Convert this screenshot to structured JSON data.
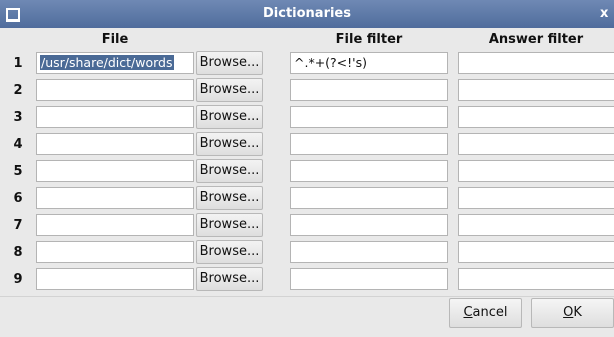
{
  "window": {
    "title": "Dictionaries",
    "close_glyph": "x"
  },
  "columns": {
    "file": "File",
    "file_filter": "File filter",
    "answer_filter": "Answer filter"
  },
  "rows": [
    {
      "num": "1",
      "file": "/usr/share/dict/words",
      "browse": "Browse...",
      "file_filter": "^.*+(?<!'s)",
      "answer_filter": ""
    },
    {
      "num": "2",
      "file": "",
      "browse": "Browse...",
      "file_filter": "",
      "answer_filter": ""
    },
    {
      "num": "3",
      "file": "",
      "browse": "Browse...",
      "file_filter": "",
      "answer_filter": ""
    },
    {
      "num": "4",
      "file": "",
      "browse": "Browse...",
      "file_filter": "",
      "answer_filter": ""
    },
    {
      "num": "5",
      "file": "",
      "browse": "Browse...",
      "file_filter": "",
      "answer_filter": ""
    },
    {
      "num": "6",
      "file": "",
      "browse": "Browse...",
      "file_filter": "",
      "answer_filter": ""
    },
    {
      "num": "7",
      "file": "",
      "browse": "Browse...",
      "file_filter": "",
      "answer_filter": ""
    },
    {
      "num": "8",
      "file": "",
      "browse": "Browse...",
      "file_filter": "",
      "answer_filter": ""
    },
    {
      "num": "9",
      "file": "",
      "browse": "Browse...",
      "file_filter": "",
      "answer_filter": ""
    }
  ],
  "buttons": {
    "cancel_mnemonic": "C",
    "cancel_rest": "ancel",
    "ok_mnemonic": "O",
    "ok_rest": "K"
  }
}
